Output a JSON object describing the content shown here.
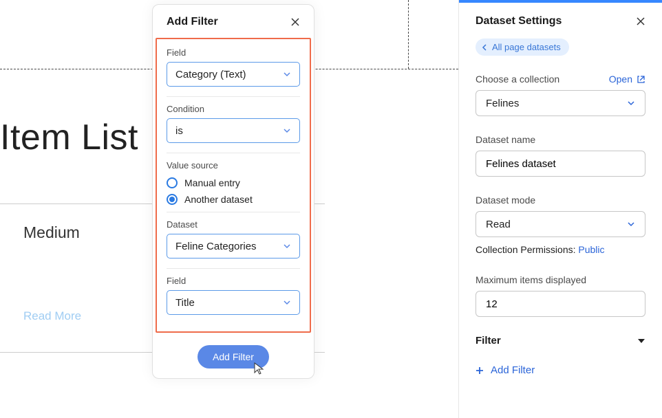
{
  "canvas": {
    "item_list_title": "Item List",
    "card_title": "Medium",
    "card_link": "Read More"
  },
  "modal": {
    "title": "Add Filter",
    "field_label": "Field",
    "field_value": "Category (Text)",
    "condition_label": "Condition",
    "condition_value": "is",
    "value_source_label": "Value source",
    "manual_entry_label": "Manual entry",
    "another_dataset_label": "Another dataset",
    "dataset_label": "Dataset",
    "dataset_value": "Feline Categories",
    "field2_label": "Field",
    "field2_value": "Title",
    "submit_button": "Add Filter"
  },
  "sidebar": {
    "title": "Dataset Settings",
    "chip_label": "All page datasets",
    "collection_label": "Choose a collection",
    "open_label": "Open",
    "collection_value": "Felines",
    "name_label": "Dataset name",
    "name_value": "Felines dataset",
    "mode_label": "Dataset mode",
    "mode_value": "Read",
    "permissions_label": "Collection Permissions: ",
    "permissions_value": "Public",
    "max_items_label": "Maximum items displayed",
    "max_items_value": "12",
    "filter_header": "Filter",
    "add_filter_link": "Add Filter"
  }
}
